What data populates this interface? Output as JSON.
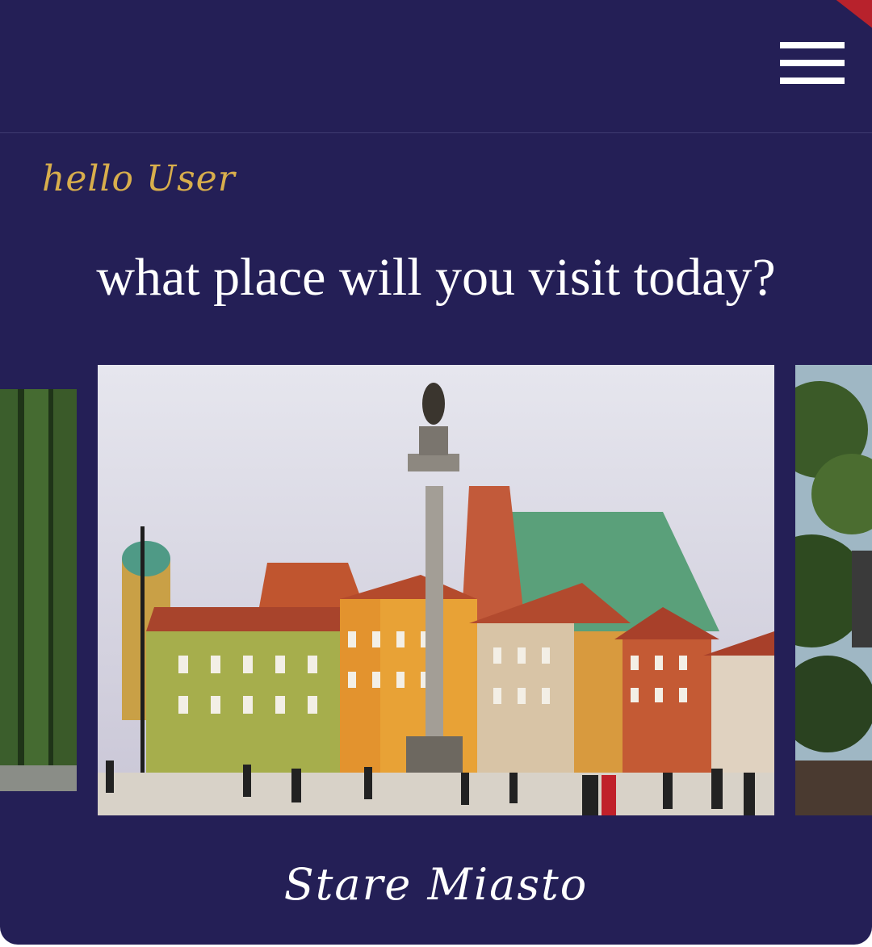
{
  "header": {
    "menu_icon": "hamburger-menu-icon",
    "accent_color": "#b8222c",
    "background_color": "#241f56"
  },
  "greeting": {
    "text": "hello User",
    "color": "#d8ae4c"
  },
  "headline": "what place will you visit today?",
  "carousel": {
    "current_place": "Stare Miasto",
    "cards": [
      {
        "position": "previous",
        "image": "ivy-covered-wall-photo"
      },
      {
        "position": "current",
        "image": "warsaw-old-town-square-photo"
      },
      {
        "position": "next",
        "image": "park-trees-photo"
      }
    ]
  }
}
